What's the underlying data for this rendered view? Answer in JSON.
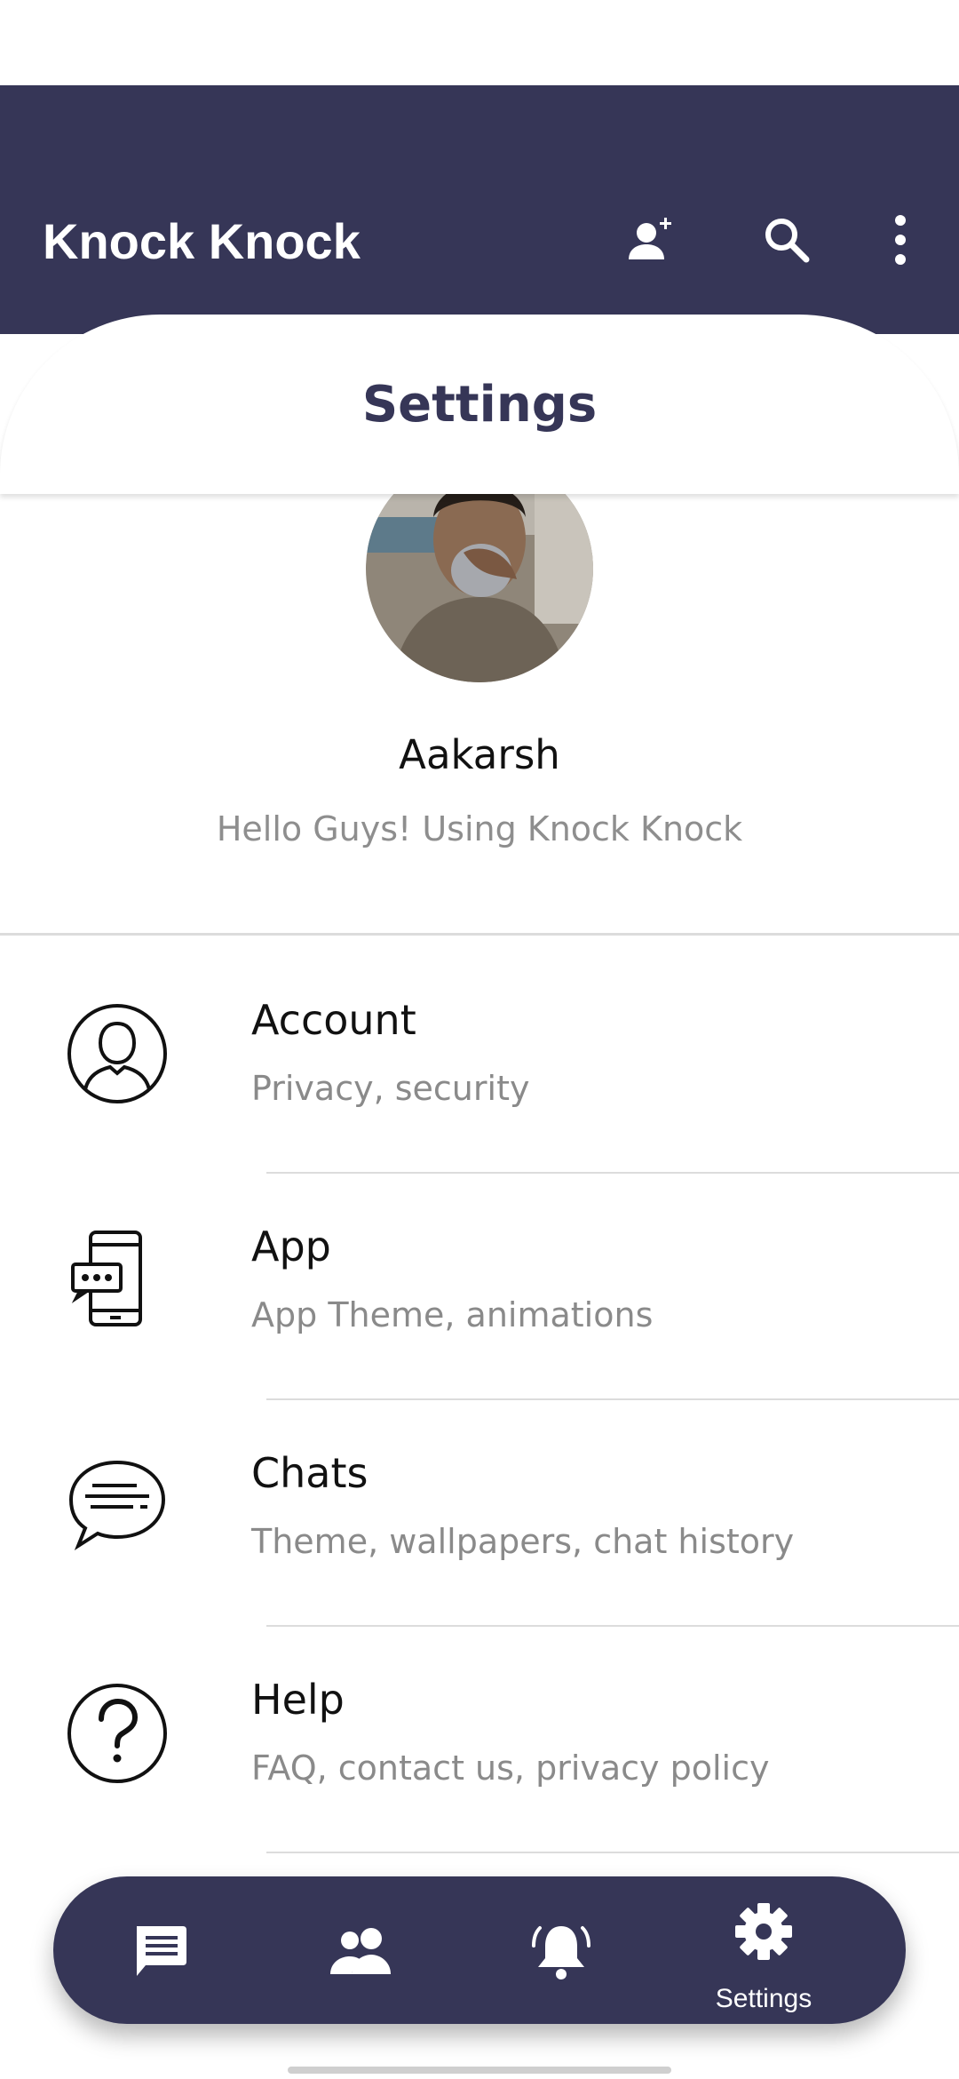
{
  "app": {
    "title": "Knock Knock",
    "accent_color": "#363657"
  },
  "header": {
    "actions": [
      {
        "icon": "add-contact-icon"
      },
      {
        "icon": "search-icon"
      },
      {
        "icon": "more-vert-icon"
      }
    ]
  },
  "screen": {
    "title": "Settings"
  },
  "profile": {
    "name": "Aakarsh",
    "status": "Hello Guys! Using Knock Knock"
  },
  "settings": {
    "items": [
      {
        "icon": "account-icon",
        "title": "Account",
        "subtitle": "Privacy, security"
      },
      {
        "icon": "app-phone-icon",
        "title": "App",
        "subtitle": "App Theme, animations"
      },
      {
        "icon": "chat-bubble-icon",
        "title": "Chats",
        "subtitle": "Theme, wallpapers, chat history"
      },
      {
        "icon": "help-icon",
        "title": "Help",
        "subtitle": "FAQ, contact us, privacy policy"
      }
    ]
  },
  "bottom_nav": {
    "items": [
      {
        "icon": "chats-icon",
        "label": ""
      },
      {
        "icon": "contacts-icon",
        "label": ""
      },
      {
        "icon": "notifications-icon",
        "label": ""
      },
      {
        "icon": "settings-gear-icon",
        "label": "Settings"
      }
    ],
    "selected": "Settings"
  }
}
